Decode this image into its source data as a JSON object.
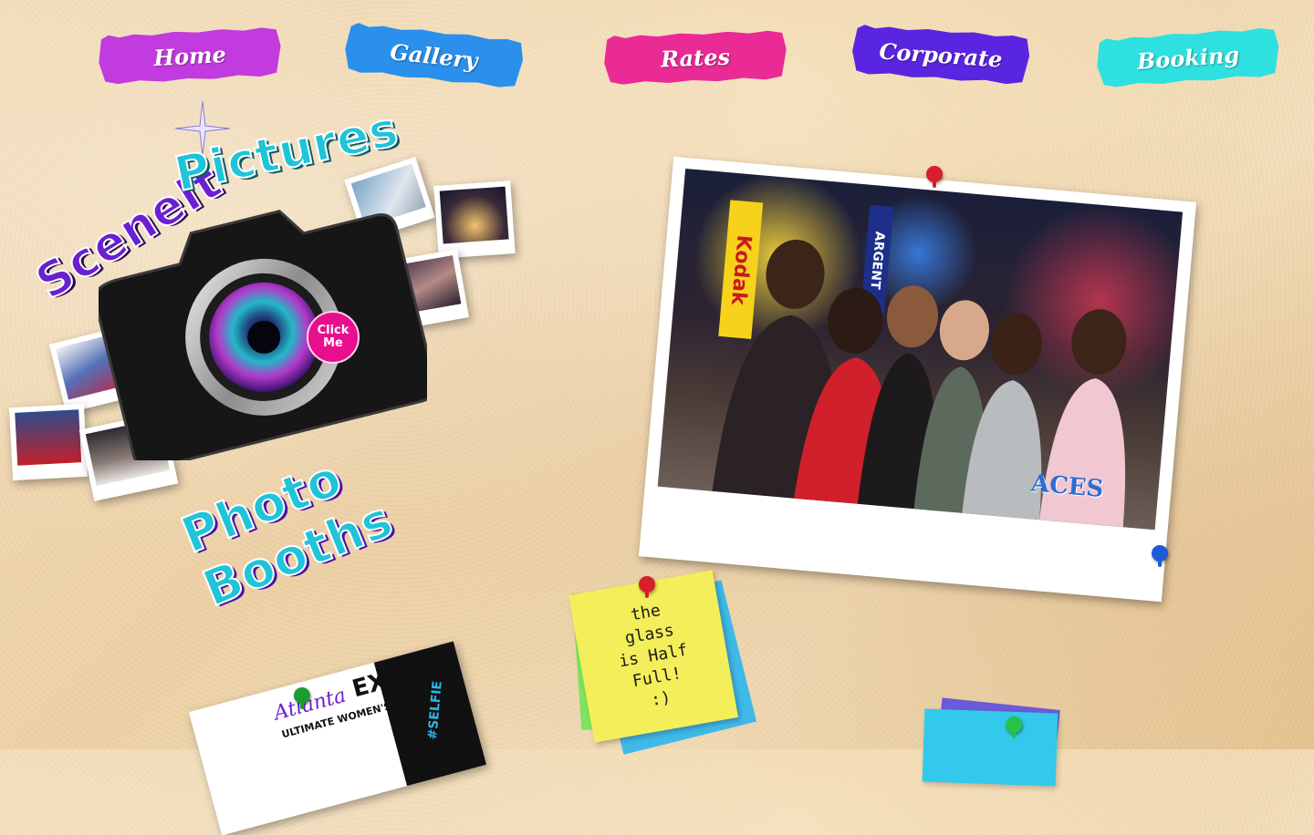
{
  "nav": {
    "items": [
      {
        "label": "Home",
        "color": "#c13bde"
      },
      {
        "label": "Gallery",
        "color": "#2b90ec"
      },
      {
        "label": "Rates",
        "color": "#ea2b95"
      },
      {
        "label": "Corporate",
        "color": "#5a25e0"
      },
      {
        "label": "Booking",
        "color": "#2fe0e0"
      }
    ]
  },
  "logo": {
    "line1_a": "SceneIt",
    "line1_b": "Pictures",
    "line2": "Photo Booths",
    "click_badge": "Click Me",
    "colors": {
      "purple": "#6a1fd0",
      "teal": "#1fc4d8",
      "pink": "#e80f8e"
    }
  },
  "hero_photo": {
    "watermark": "ACES",
    "signs": [
      "Kodak",
      "ARGENT"
    ]
  },
  "sticky_note": {
    "text": "the glass is Half Full! :)"
  },
  "expo_card": {
    "title_script": "Atlanta",
    "title": "EXPO",
    "subtitle": "ULTIMATE WOMEN'S",
    "hashtag": "#SELFIE"
  }
}
